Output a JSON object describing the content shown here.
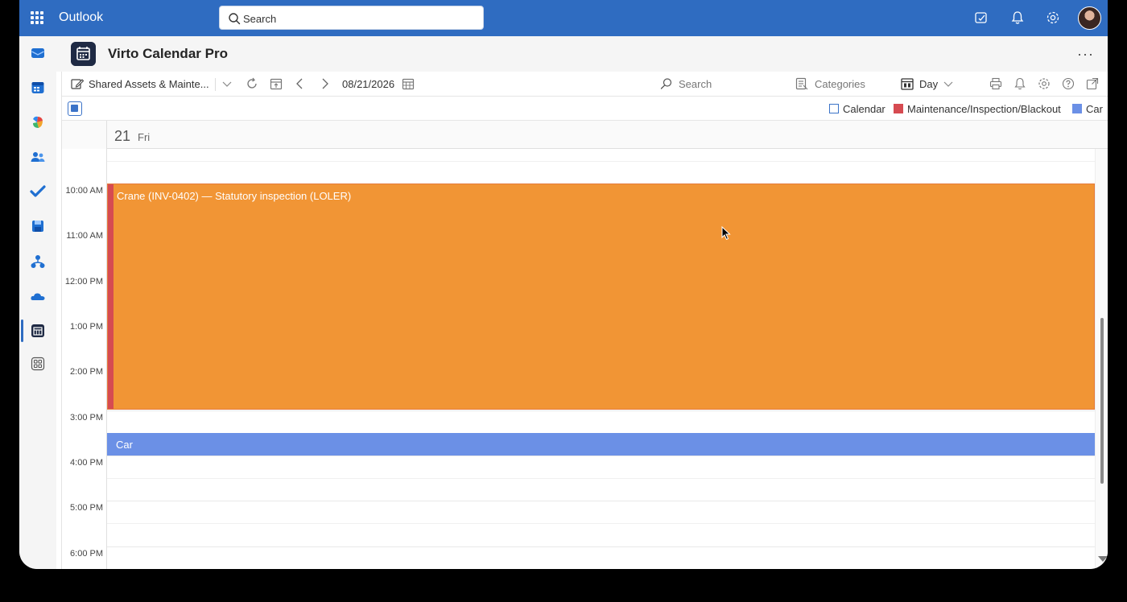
{
  "topbar": {
    "app_name": "Outlook",
    "search_placeholder": "Search",
    "bg_color": "#2f6cc1"
  },
  "rail": {
    "items": [
      "mail-icon",
      "calendar-icon",
      "copilot-icon",
      "people-icon",
      "todo-icon",
      "save-icon",
      "org-icon",
      "onedrive-icon",
      "virto-calendar-icon",
      "apps-icon"
    ],
    "active": "virto-calendar-icon"
  },
  "app": {
    "title": "Virto Calendar Pro",
    "more": "···"
  },
  "toolbar": {
    "calendar_selector": "Shared Assets & Mainte...",
    "date": "08/21/2026",
    "search_placeholder": "Search",
    "categories_label": "Categories",
    "view_label": "Day"
  },
  "legend": {
    "items": [
      {
        "label": "Calendar",
        "color": "#3b73c8"
      },
      {
        "label": "Maintenance/Inspection/Blackout",
        "color": "#d64b51"
      },
      {
        "label": "Car",
        "color": "#6b90e6"
      }
    ]
  },
  "day": {
    "number": "21",
    "name": "Fri"
  },
  "times": [
    "10:00 AM",
    "11:00 AM",
    "12:00 PM",
    "1:00 PM",
    "2:00 PM",
    "3:00 PM",
    "4:00 PM",
    "5:00 PM",
    "6:00 PM"
  ],
  "events": {
    "crane": {
      "title": "Crane (INV-0402) — Statutory inspection (LOLER)",
      "color": "#f19535",
      "category_color": "#d64b51"
    },
    "car": {
      "title": "Car",
      "color": "#6b90e6"
    }
  }
}
